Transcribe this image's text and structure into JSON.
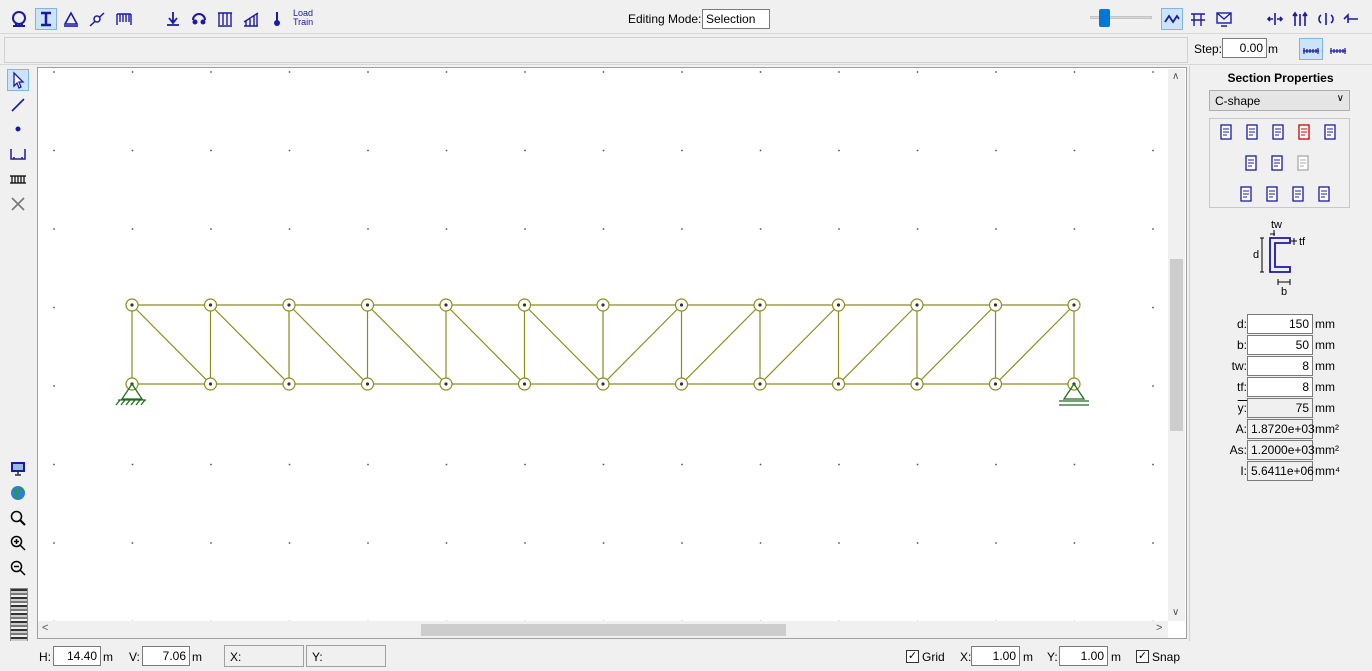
{
  "toolbar": {
    "editing_mode_label": "Editing Mode:",
    "editing_mode_value": "Selection",
    "load_train_label_1": "Load",
    "load_train_label_2": "Train",
    "step_label": "Step:",
    "step_value": "0.00",
    "step_unit": "m"
  },
  "section": {
    "title": "Section Properties",
    "shape_select": "C-shape",
    "diagram_labels": {
      "tw": "tw",
      "tf": "tf",
      "d": "d",
      "b": "b"
    },
    "props": [
      {
        "label": "d:",
        "value": "150",
        "unit": "mm",
        "editable": true
      },
      {
        "label": "b:",
        "value": "50",
        "unit": "mm",
        "editable": true
      },
      {
        "label": "tw:",
        "value": "8",
        "unit": "mm",
        "editable": true
      },
      {
        "label": "tf:",
        "value": "8",
        "unit": "mm",
        "editable": true
      },
      {
        "label": "y:",
        "value": "75",
        "unit": "mm",
        "editable": false
      },
      {
        "label": "A:",
        "value": "1.8720e+03",
        "unit": "mm²",
        "editable": false
      },
      {
        "label": "As:",
        "value": "1.2000e+03",
        "unit": "mm²",
        "editable": false
      },
      {
        "label": "I:",
        "value": "5.6411e+06",
        "unit": "mm⁴",
        "editable": false
      }
    ]
  },
  "status": {
    "h_label": "H:",
    "h_value": "14.40",
    "h_unit": "m",
    "v_label": "V:",
    "v_value": "7.06",
    "v_unit": "m",
    "x_readout": "X:",
    "y_readout": "Y:",
    "grid_label": "Grid",
    "grid_checked": true,
    "gx_label": "X:",
    "gx_value": "1.00",
    "gx_unit": "m",
    "gy_label": "Y:",
    "gy_value": "1.00",
    "gy_unit": "m",
    "snap_label": "Snap",
    "snap_checked": true
  },
  "icons": {
    "top_left": [
      "structure-icon",
      "section-icon",
      "support-icon",
      "hinge-icon",
      "truss-icon"
    ],
    "loads": [
      "point-load-icon",
      "moment-load-icon",
      "distributed-load-icon",
      "trapezoid-load-icon",
      "temperature-load-icon"
    ],
    "top_right": [
      "deformed-shape-icon",
      "frame-results-icon",
      "envelope-icon",
      "axial-force-icon",
      "shear-force-icon",
      "bending-moment-icon",
      "influence-line-icon"
    ],
    "left_tools": [
      "select-arrow-icon",
      "draw-line-icon",
      "node-point-icon",
      "support-tool-icon",
      "load-tool-icon",
      "delete-icon"
    ],
    "left_view": [
      "monitor-icon",
      "globe-icon",
      "zoom-icon",
      "zoom-in-icon",
      "zoom-out-icon"
    ]
  },
  "colors": {
    "member": "#8c8c1e",
    "support": "#1e6e1e",
    "accent": "#0078d7",
    "section_blue": "#1a1aa6"
  },
  "model": {
    "top_chord_y_m": 0,
    "bottom_chord_y_m": -1,
    "nodes_x_m": [
      0,
      1,
      2,
      3,
      4,
      5,
      6,
      7,
      8,
      9,
      10,
      11,
      12
    ]
  },
  "zoom_slider_fraction": 0.18
}
